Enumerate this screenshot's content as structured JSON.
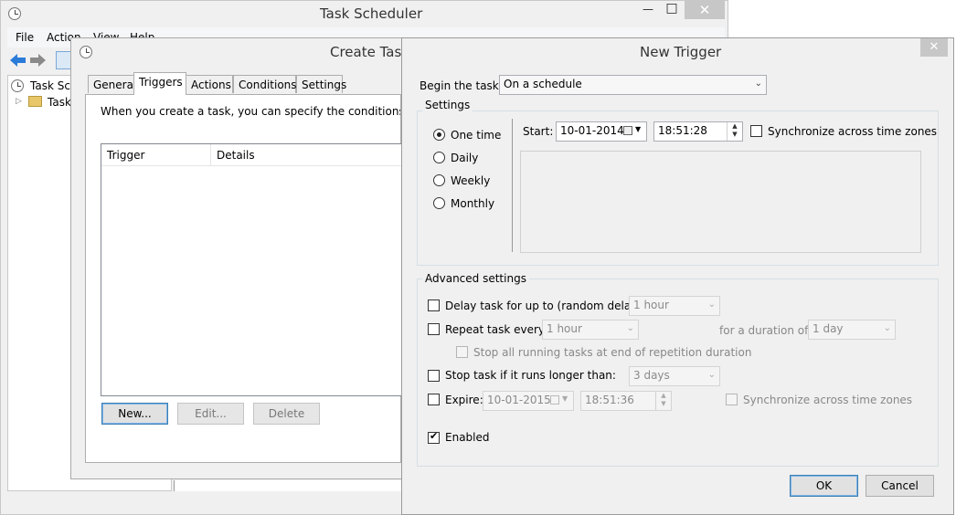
{
  "scheduler": {
    "title": "Task Scheduler",
    "menu": [
      "File",
      "Action",
      "View",
      "Help"
    ],
    "minimize": "—",
    "maximize": "□",
    "close": "✕",
    "tree": [
      "Task Sch",
      "Task"
    ]
  },
  "create_task": {
    "title": "Create Task",
    "tabs": [
      "General",
      "Triggers",
      "Actions",
      "Conditions",
      "Settings"
    ],
    "intro": "When you create a task, you can specify the conditions that wi",
    "columns": [
      "Trigger",
      "Details"
    ],
    "buttons": {
      "new": "New...",
      "edit": "Edit...",
      "delete": "Delete"
    }
  },
  "new_trigger": {
    "title": "New Trigger",
    "close": "✕",
    "begin_label": "Begin the task:",
    "begin_value": "On a schedule",
    "settings_label": "Settings",
    "radios": [
      "One time",
      "Daily",
      "Weekly",
      "Monthly"
    ],
    "selected_radio": "One time",
    "start_label": "Start:",
    "start_date": "10-01-2014",
    "start_time": "18:51:28",
    "sync_label": "Synchronize across time zones",
    "advanced_label": "Advanced settings",
    "delay_label": "Delay task for up to (random delay):",
    "delay_value": "1 hour",
    "repeat_label": "Repeat task every:",
    "repeat_value": "1 hour",
    "duration_label": "for a duration of:",
    "duration_value": "1 day",
    "stop_all_label": "Stop all running tasks at end of repetition duration",
    "stop_if_label": "Stop task if it runs longer than:",
    "stop_if_value": "3 days",
    "expire_label": "Expire:",
    "expire_date": "10-01-2015",
    "expire_time": "18:51:36",
    "expire_sync_label": "Synchronize across time zones",
    "enabled_label": "Enabled",
    "ok": "OK",
    "cancel": "Cancel"
  }
}
